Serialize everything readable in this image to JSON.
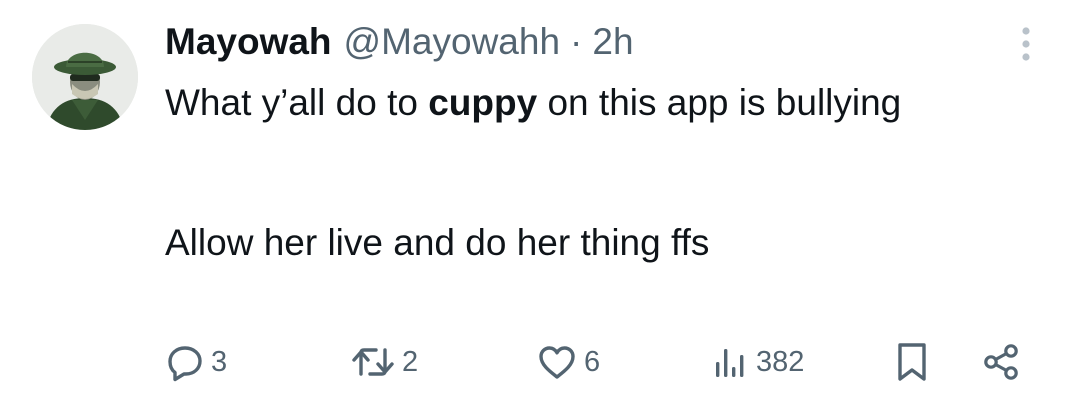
{
  "tweet": {
    "display_name": "Mayowah",
    "handle": "@Mayowahh",
    "separator": "·",
    "time": "2h",
    "text_part1": "What y’all do to ",
    "mention": "cuppy",
    "text_part2": " on this app is bullying",
    "paragraph2": "Allow her live and do her thing ffs"
  },
  "actions": {
    "replies": "3",
    "reposts": "2",
    "likes": "6",
    "views": "382"
  },
  "icons": {
    "more": "more-vertical-icon",
    "reply": "reply-icon",
    "repost": "repost-icon",
    "like": "heart-icon",
    "views": "views-chart-icon",
    "bookmark": "bookmark-icon",
    "share": "share-icon"
  },
  "colors": {
    "text": "#0f1419",
    "secondary": "#536471",
    "more_dots": "#b9c2ca",
    "background": "#ffffff"
  }
}
